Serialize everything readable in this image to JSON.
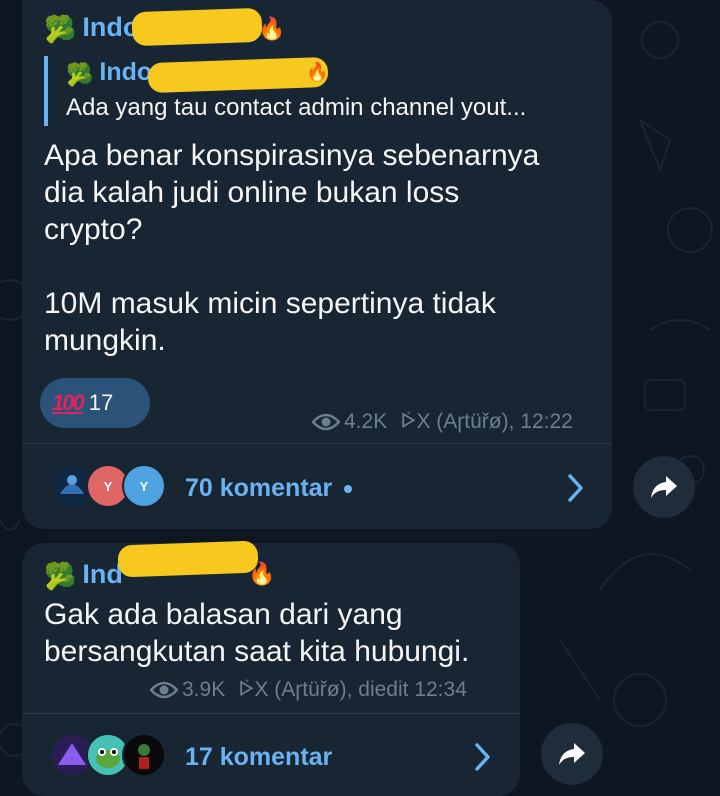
{
  "colors": {
    "background": "#0e1621",
    "bubble": "#182533",
    "accent": "#6ab3f3",
    "meta": "#6d7f8f",
    "reaction_bg": "#2b5278"
  },
  "messages": [
    {
      "sender": "Indo",
      "sender_icon": "broccoli-icon",
      "reply": {
        "sender": "Indo",
        "text": "Ada yang tau contact admin channel yout..."
      },
      "text": "Apa benar konspirasinya sebenarnya\ndia kalah judi online bukan loss\ncrypto?\n\n10M masuk micin sepertinya tidak\nmungkin.",
      "reaction": {
        "emoji": "100",
        "count": "17"
      },
      "views": "4.2K",
      "author_time": "ᢰX (Aɼtüřø), 12:22",
      "comments": {
        "label": "70 komentar",
        "avatars": [
          "",
          "Y",
          "Y"
        ]
      }
    },
    {
      "sender": "Ind",
      "sender_icon": "broccoli-icon",
      "text": "Gak ada balasan dari yang\nbersangkutan saat kita hubungi.",
      "views": "3.9K",
      "author_time": "ᢰX (Aɼtüřø), diedit 12:34",
      "comments": {
        "label": "17 komentar",
        "avatars": [
          "",
          "",
          ""
        ]
      }
    }
  ]
}
